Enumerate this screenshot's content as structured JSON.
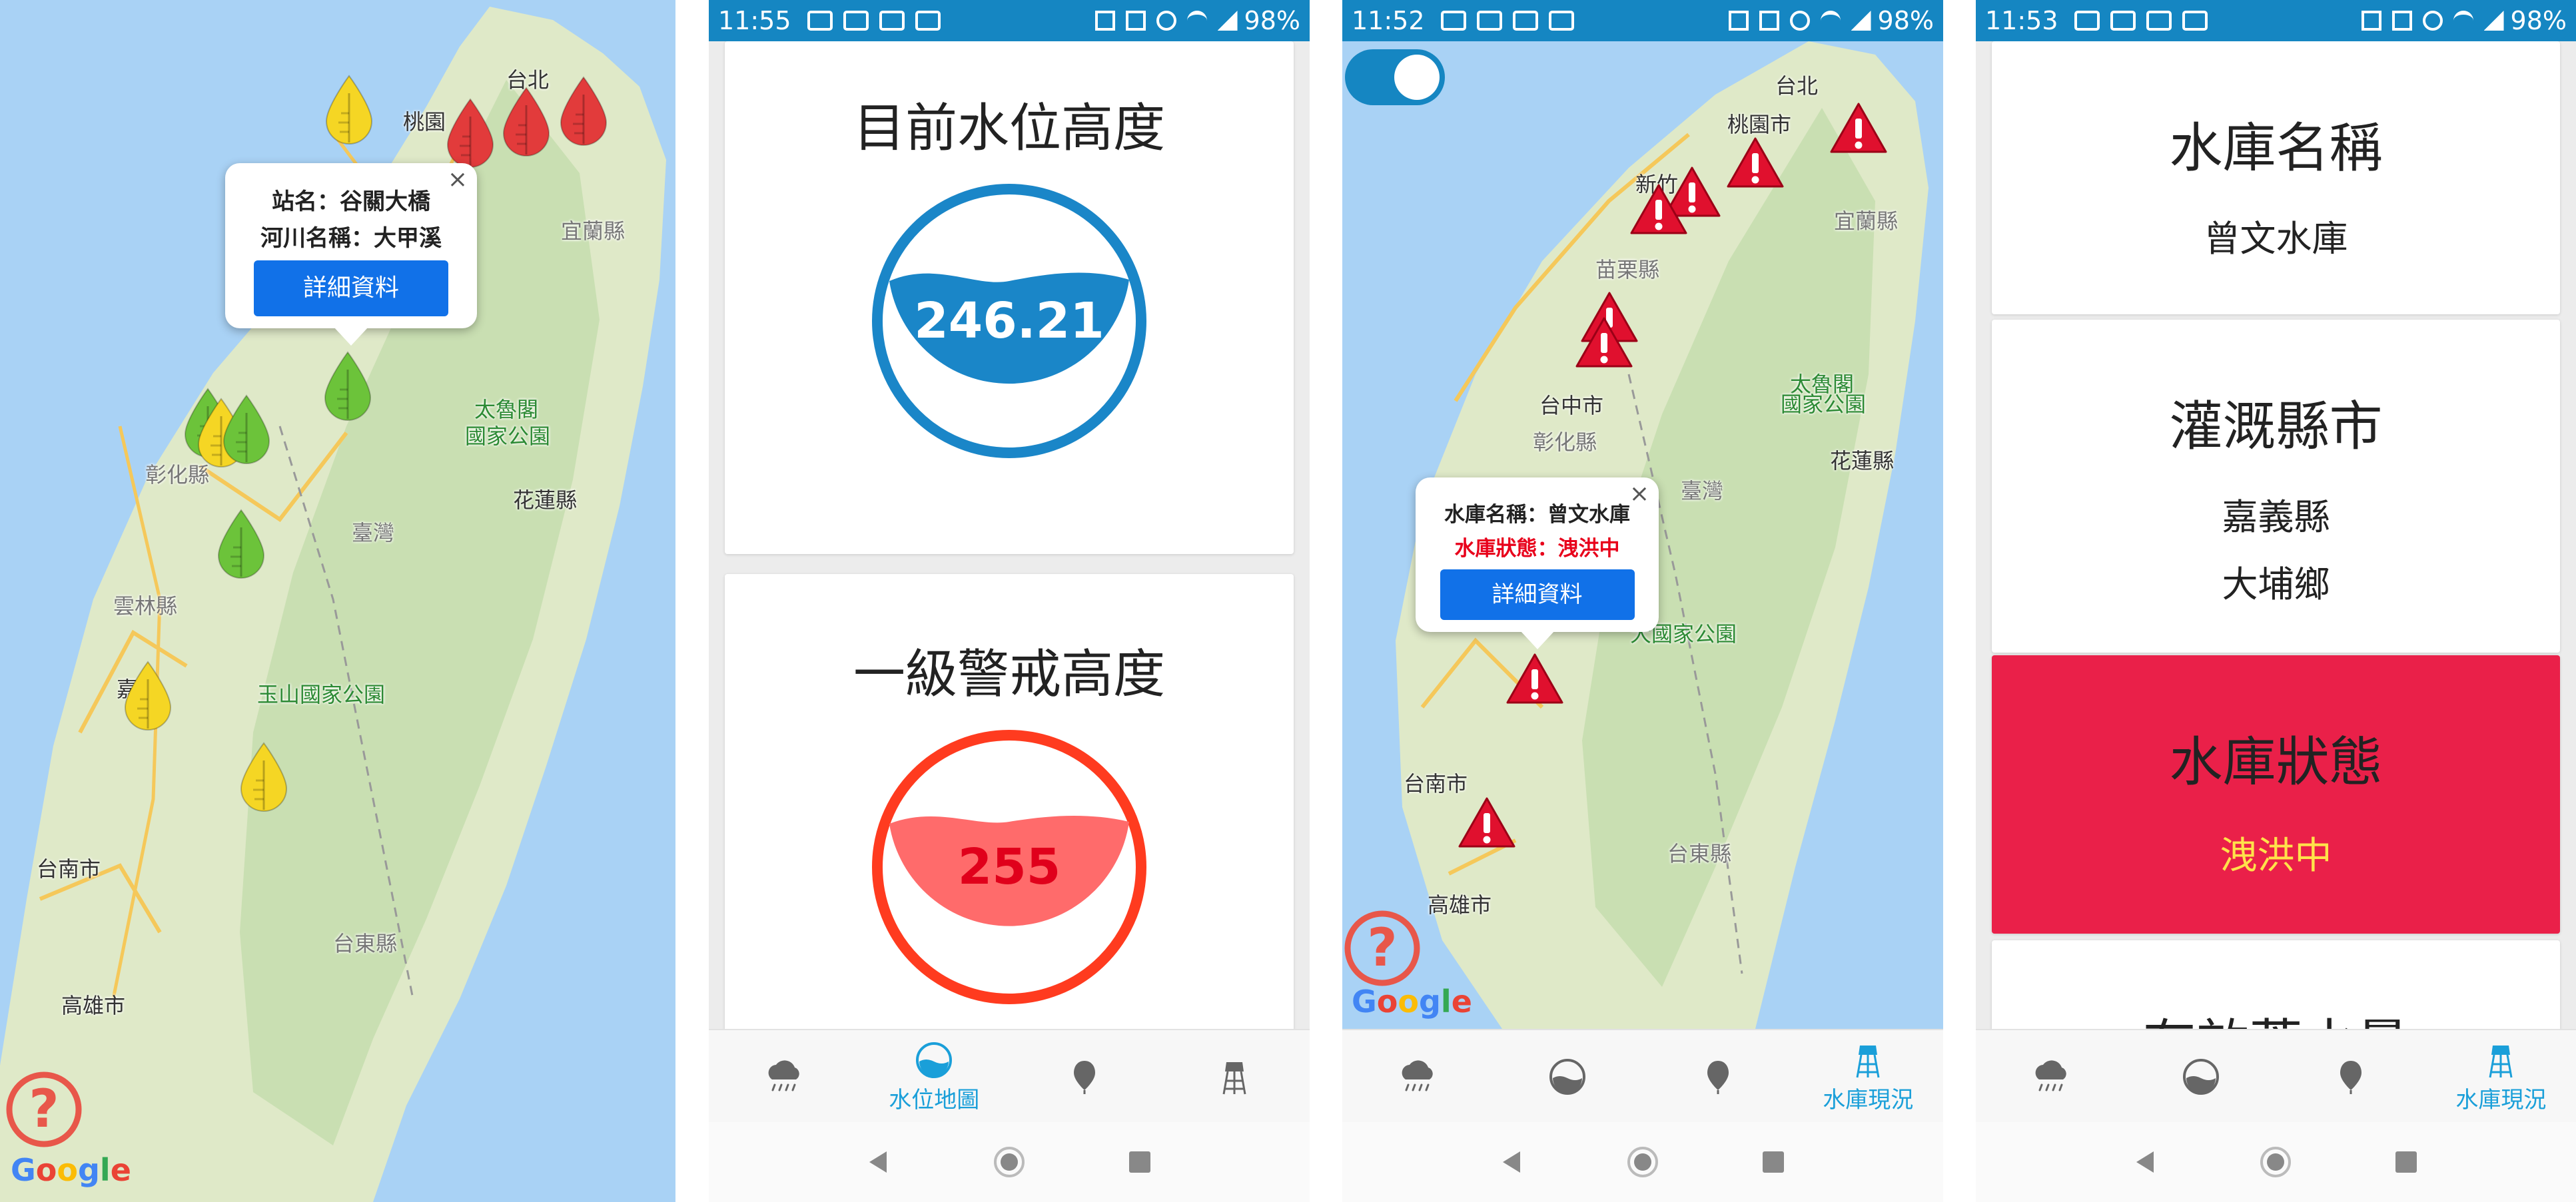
{
  "screens": {
    "s1": {
      "map_labels": [
        "台北",
        "桃園",
        "宜蘭縣",
        "太魯閣",
        "國家公園",
        "花蓮縣",
        "彰化縣",
        "臺灣",
        "雲林縣",
        "嘉市",
        "玉山國家公園",
        "台南市",
        "台東縣",
        "高雄市"
      ],
      "popup": {
        "line1": "站名：谷關大橋",
        "line2": "河川名稱：大甲溪",
        "button": "詳細資料",
        "close": "×"
      },
      "google": [
        "G",
        "o",
        "o",
        "g",
        "l",
        "e"
      ]
    },
    "s2": {
      "status": {
        "time": "11:55",
        "battery": "98%"
      },
      "card1": {
        "title": "目前水位高度",
        "value": "246.21"
      },
      "card2": {
        "title": "一級警戒高度",
        "value": "255"
      },
      "nav_active_label": "水位地圖"
    },
    "s3": {
      "status": {
        "time": "11:52",
        "battery": "98%"
      },
      "map_labels": [
        "台北",
        "桃園市",
        "新竹",
        "宜蘭縣",
        "苗栗縣",
        "台中市",
        "太魯閣",
        "國家公園",
        "彰化縣",
        "花蓮縣",
        "臺灣",
        "大國家公園",
        "台南市",
        "台東縣",
        "高雄市"
      ],
      "popup": {
        "line1": "水庫名稱：曾文水庫",
        "line2": "水庫狀態：洩洪中",
        "button": "詳細資料",
        "close": "×"
      },
      "nav_active_label": "水庫現況"
    },
    "s4": {
      "status": {
        "time": "11:53",
        "battery": "98%"
      },
      "card1": {
        "title": "水庫名稱",
        "value": "曾文水庫"
      },
      "card2": {
        "title": "灌溉縣市",
        "value1": "嘉義縣",
        "value2": "大埔鄉"
      },
      "card3": {
        "title": "水庫狀態",
        "value": "洩洪中"
      },
      "card4": {
        "title": "有效蓄水量"
      },
      "nav_active_label": "水庫現況"
    }
  },
  "colors": {
    "accent": "#1586c2",
    "water_blue": "#1a86c8",
    "alarm_red": "#ff3b1f",
    "alarm_fill": "#ff6b6b",
    "status_card": "#ea2049",
    "status_text": "#ffe24a",
    "popup_button": "#1171e8"
  },
  "icons": {
    "rain": "rain-cloud-icon",
    "water": "water-level-icon",
    "pin": "map-pin-icon",
    "tower": "water-tower-icon",
    "help": "question-icon",
    "warning": "warning-marker-icon",
    "drop": "water-drop-marker-icon"
  }
}
